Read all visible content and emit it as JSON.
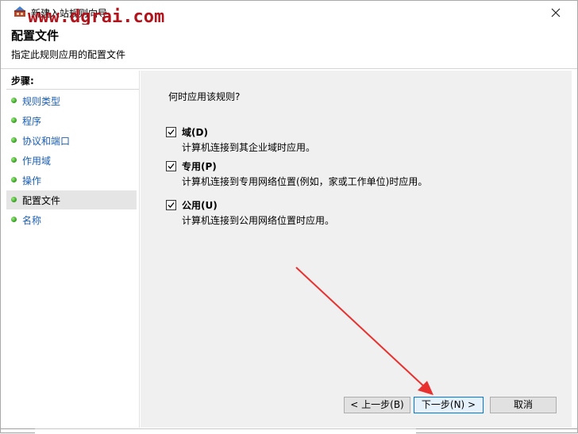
{
  "window": {
    "title": "新建入站规则向导",
    "watermark": "www.dgrai.com"
  },
  "header": {
    "title": "配置文件",
    "description": "指定此规则应用的配置文件"
  },
  "sidebar": {
    "title": "步骤:",
    "items": [
      {
        "label": "规则类型",
        "current": false
      },
      {
        "label": "程序",
        "current": false
      },
      {
        "label": "协议和端口",
        "current": false
      },
      {
        "label": "作用域",
        "current": false
      },
      {
        "label": "操作",
        "current": false
      },
      {
        "label": "配置文件",
        "current": true
      },
      {
        "label": "名称",
        "current": false
      }
    ]
  },
  "main": {
    "question": "何时应用该规则?",
    "options": [
      {
        "label": "域(D)",
        "description": "计算机连接到其企业域时应用。",
        "checked": true
      },
      {
        "label": "专用(P)",
        "description": "计算机连接到专用网络位置(例如，家或工作单位)时应用。",
        "checked": true
      },
      {
        "label": "公用(U)",
        "description": "计算机连接到公用网络位置时应用。",
        "checked": true
      }
    ]
  },
  "buttons": {
    "back": "< 上一步(B)",
    "next": "下一步(N) >",
    "cancel": "取消"
  },
  "colors": {
    "annotation_arrow": "#e8312f",
    "link": "#1a5fb4",
    "watermark": "#b0141d"
  }
}
